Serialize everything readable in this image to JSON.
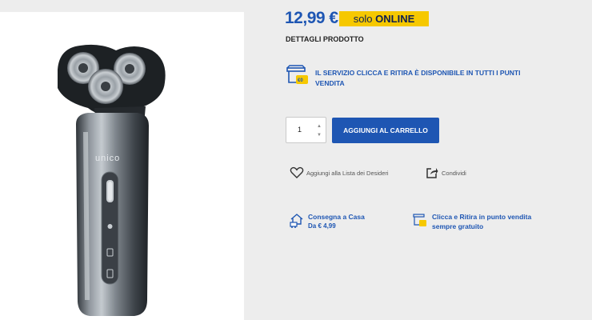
{
  "product": {
    "price": "12,99 €",
    "badge_prefix": "solo",
    "badge_main": "ONLINE",
    "details_heading": "DETTAGLI PRODOTTO",
    "brand_on_image": "unico"
  },
  "service": {
    "text": "IL SERVIZIO CLICCA E RITIRA  È DISPONIBILE  IN TUTTI I PUNTI VENDITA"
  },
  "cart": {
    "quantity": "1",
    "add_label": "AGGIUNGI AL CARRELLO"
  },
  "actions": {
    "wishlist_label": "Aggiungi alla Lista dei Desideri",
    "share_label": "Condividi"
  },
  "delivery": {
    "title": "Consegna a Casa",
    "price": "Da € 4,99"
  },
  "pickup": {
    "line1": "Clicca e Ritira in punto vendita",
    "line2": "sempre gratuito"
  },
  "colors": {
    "accent": "#1e56b3",
    "badge": "#f6c800"
  }
}
